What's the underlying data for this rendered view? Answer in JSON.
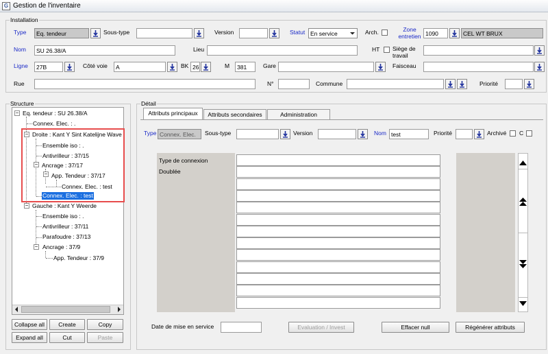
{
  "window": {
    "title": "Gestion de l'inventaire",
    "icon": "inventory-app-icon"
  },
  "installation": {
    "group_title": "Installation",
    "type_label": "Type",
    "type_value": "Eq. tendeur",
    "soustype_label": "Sous-type",
    "soustype_value": "",
    "version_label": "Version",
    "version_value": "",
    "statut_label": "Statut",
    "statut_value": "En service",
    "arch_label": "Arch.",
    "zone_label": "Zone entretien",
    "zone_code": "1090",
    "zone_name": "CEL WT BRUX",
    "nom_label": "Nom",
    "nom_value": "SU 26.38/A",
    "lieu_label": "Lieu",
    "lieu_value": "",
    "ht_label": "HT",
    "siege_label": "Siège de travail",
    "siege_value": "",
    "ligne_label": "Ligne",
    "ligne_value": "27B",
    "cote_label": "Côté voie",
    "cote_value": "A",
    "bk_label": "BK",
    "bk_value": "26",
    "m_label": "M",
    "m_value": "381",
    "gare_label": "Gare",
    "gare_value": "",
    "faisceau_label": "Faisceau",
    "faisceau_value": "",
    "rue_label": "Rue",
    "rue_value": "",
    "no_label": "N°",
    "no_value": "",
    "commune_label": "Commune",
    "commune_value": "",
    "priorite_label": "Priorité",
    "priorite_value": ""
  },
  "structure": {
    "group_title": "Structure",
    "nodes": [
      "Eq. tendeur : SU 26.38/A",
      "Connex. Elec. : .",
      "Droite : Kant Y Sint Katelijne Wave",
      "Ensemble iso : .",
      "Antivrilleur : 37/15",
      "Ancrage : 37/17",
      "App. Tendeur : 37/17",
      "Connex. Elec. : test",
      "Connex. Elec. : test",
      "Gauche : Kant Y Weerde",
      "Ensemble iso : .",
      "Antivrilleur : 37/11",
      "Parafoudre : 37/13",
      "Ancrage : 37/9",
      "App. Tendeur : 37/9"
    ],
    "buttons": {
      "collapse_all": "Collapse all",
      "create": "Create",
      "copy": "Copy",
      "expand_all": "Expand all",
      "cut": "Cut",
      "paste": "Paste"
    }
  },
  "detail": {
    "group_title": "Détail",
    "tabs": [
      "Attributs principaux",
      "Attributs secondaires",
      "Administration"
    ],
    "type_label": "Type",
    "type_value": "Connex. Elec.",
    "soustype_label": "Sous-type",
    "soustype_value": "",
    "version_label": "Version",
    "version_value": "",
    "nom_label": "Nom",
    "nom_value": "test",
    "priorite_label": "Priorité",
    "priorite_value": "",
    "archive_label": "Archivé",
    "c_label": "C",
    "attributes": [
      "Type de connexion",
      "Doublée"
    ],
    "date_label": "Date de mise en service",
    "date_value": "",
    "buttons": {
      "evaluation": "Evaluation / Invest",
      "effacer": "Effacer null",
      "regenerer": "Régénérer attributs"
    }
  },
  "colors": {
    "label_blue": "#1a29c7",
    "selection": "#1b6fe0",
    "highlight_box": "#e74c4c"
  }
}
